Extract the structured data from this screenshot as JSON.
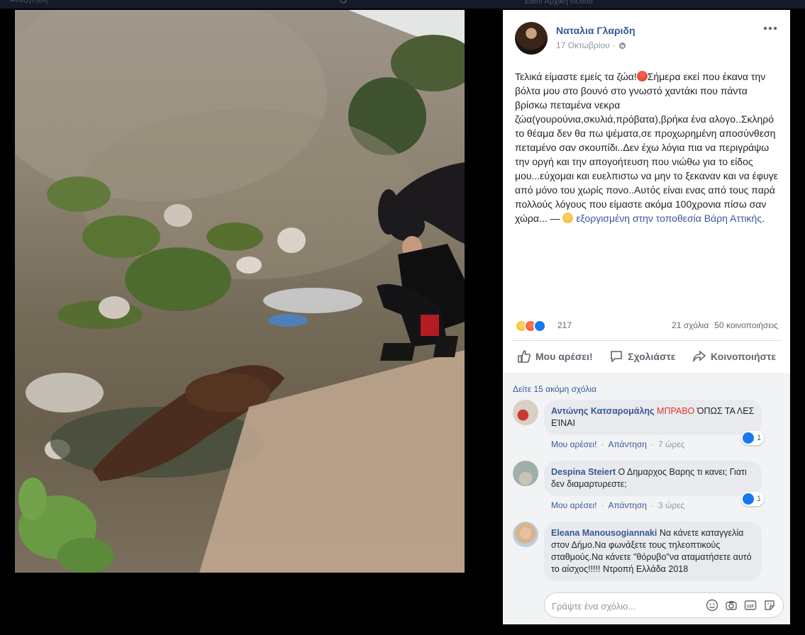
{
  "topbar": {
    "search_placeholder": "Αναζήτηση",
    "nav_text": "Eleni   Αρχική σελίδα"
  },
  "post": {
    "author": "Ναταλια Γλαριδη",
    "date": "17 Οκτωβρίου",
    "date_separator": "·",
    "text_before": "Τελικά είμαστε εμείς τα ζώα!",
    "text_main": "Σήμερα εκεί που έκανα την βόλτα μου στο βουνό στο γνωστό χαντάκι που πάντα βρίσκω πεταμένα νεκρα ζώα(γουρούνια,σκυλιά,πρόβατα),βρήκα ένα αλογο..Σκληρό το θέαμα δεν θα πω ψέματα,σε προχωρημένη αποσύνθεση πεταμένο σαν σκουπίδι..Δεν έχω λόγια πια να περιγράψω την οργή και την απογοήτευση που νιώθω για το είδος μου...εύχομαι και ευελπιστω να μην το ξεκαναν και να έφυγε από μόνο του χωρίς πονο..Αυτός είναι ενας από τους παρά πολλούς λόγους που είμαστε ακόμα 100χρονια πίσω σαν χώρα... —",
    "feeling": "εξοργισμένη",
    "location_prefix": "στην τοποθεσία",
    "location": "Βάρη Αττικής",
    "reaction_count": "217",
    "comments_count": "21 σχόλια",
    "shares_count": "50 κοινοποιήσεις",
    "actions": {
      "like": "Μου αρέσει!",
      "comment": "Σχολιάστε",
      "share": "Κοινοποιήστε"
    }
  },
  "comments": {
    "see_more": "Δείτε 15 ακόμη σχόλια",
    "like_label": "Μου αρέσει!",
    "reply_label": "Απάντηση",
    "items": [
      {
        "name": "Αντώνης Κατσαρομάλης",
        "text_caps": "ΜΠΡΑΒΟ",
        "text": "ΌΠΩΣ ΤΑ ΛΕΣ ΕΊΝΑΙ",
        "time": "7 ώρες",
        "likes": "1"
      },
      {
        "name": "Despina Steiert",
        "text": "Ο Δημαρχος Βαρης τι κανει; Γιατι δεν διαμαρτυρεστε;",
        "time": "3 ώρες",
        "likes": "1"
      },
      {
        "name": "Eleana Manousogiannaki",
        "text": "Να κάνετε καταγγελία στον Δήμο.Να φωνάξετε τους τηλεοπτικούς σταθμούς.Να κάνετε \"θόρυβο\"να αταματήσετε αυτό το αίσχος!!!!! Ντροπή Ελλάδα 2018"
      }
    ]
  },
  "input": {
    "placeholder": "Γράψτε ένα σχόλιο..."
  },
  "colors": {
    "link": "#385898",
    "like_blue": "#1877f2",
    "caps_red": "#e0332b"
  },
  "icons": [
    "search-icon",
    "globe-icon",
    "more-icon",
    "like-icon",
    "comment-icon",
    "share-icon",
    "smiley-icon",
    "camera-icon",
    "gif-icon",
    "sticker-icon"
  ]
}
